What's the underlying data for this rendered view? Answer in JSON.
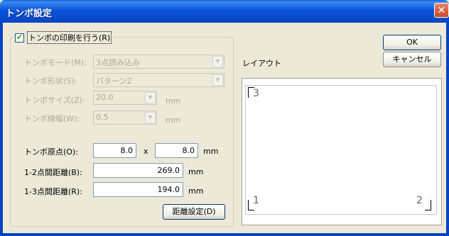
{
  "window": {
    "title": "トンボ設定",
    "close": "✕"
  },
  "group": {
    "label": "トンボの印刷を行う(R)",
    "checked": "✔"
  },
  "mode": {
    "label": "トンボモード(M):",
    "value": "3点読み込み"
  },
  "shape": {
    "label": "トンボ形状(S):",
    "value": "パターン2"
  },
  "size": {
    "label": "トンボサイズ(Z):",
    "value": "20.0",
    "unit": "mm"
  },
  "width": {
    "label": "トンボ線幅(W):",
    "value": "0.5",
    "unit": "mm"
  },
  "origin": {
    "label": "トンボ原点(O):",
    "x": "8.0",
    "sep": "x",
    "y": "8.0",
    "unit": "mm"
  },
  "dist12": {
    "label": "1-2点間距離(B):",
    "value": "269.0",
    "unit": "mm"
  },
  "dist13": {
    "label": "1-3点間距離(R):",
    "value": "194.0",
    "unit": "mm"
  },
  "distance_button": "距離設定(D)",
  "ok_button": "OK",
  "cancel_button": "キャンセル",
  "layout": {
    "label": "レイアウト",
    "p1": "1",
    "p2": "2",
    "p3": "3"
  }
}
